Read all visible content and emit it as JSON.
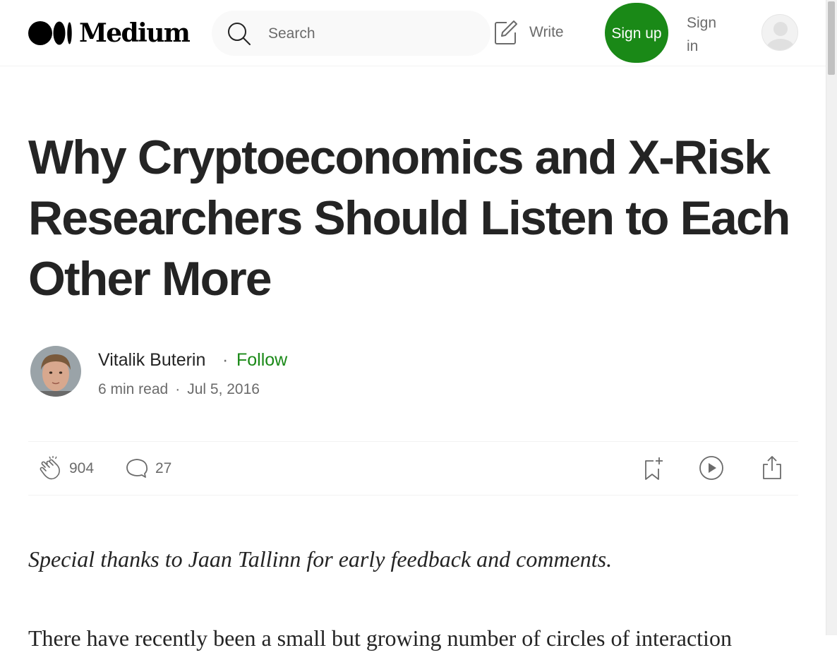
{
  "header": {
    "logo_text": "Medium",
    "search_placeholder": "Search",
    "write_label": "Write",
    "signup_label": "Sign up",
    "signin_label": "Sign in"
  },
  "article": {
    "title": "Why Cryptoeconomics and X-Risk Researchers Should Listen to Each Other More",
    "author": {
      "name": "Vitalik Buterin",
      "separator": "·",
      "follow_label": "Follow"
    },
    "read_time": "6 min read",
    "meta_separator": "·",
    "date": "Jul 5, 2016",
    "claps": "904",
    "responses": "27",
    "intro_italic": "Special thanks to Jaan Tallinn for early feedback and comments.",
    "first_paragraph": "There have recently been a small but growing number of circles of interaction"
  },
  "colors": {
    "brand_green": "#1a8917",
    "text": "#242424",
    "muted": "#6b6b6b"
  },
  "icons": {
    "search": "search-icon",
    "write": "write-icon",
    "clap": "clap-icon",
    "response": "comment-icon",
    "save": "bookmark-add-icon",
    "listen": "play-icon",
    "share": "share-icon"
  }
}
